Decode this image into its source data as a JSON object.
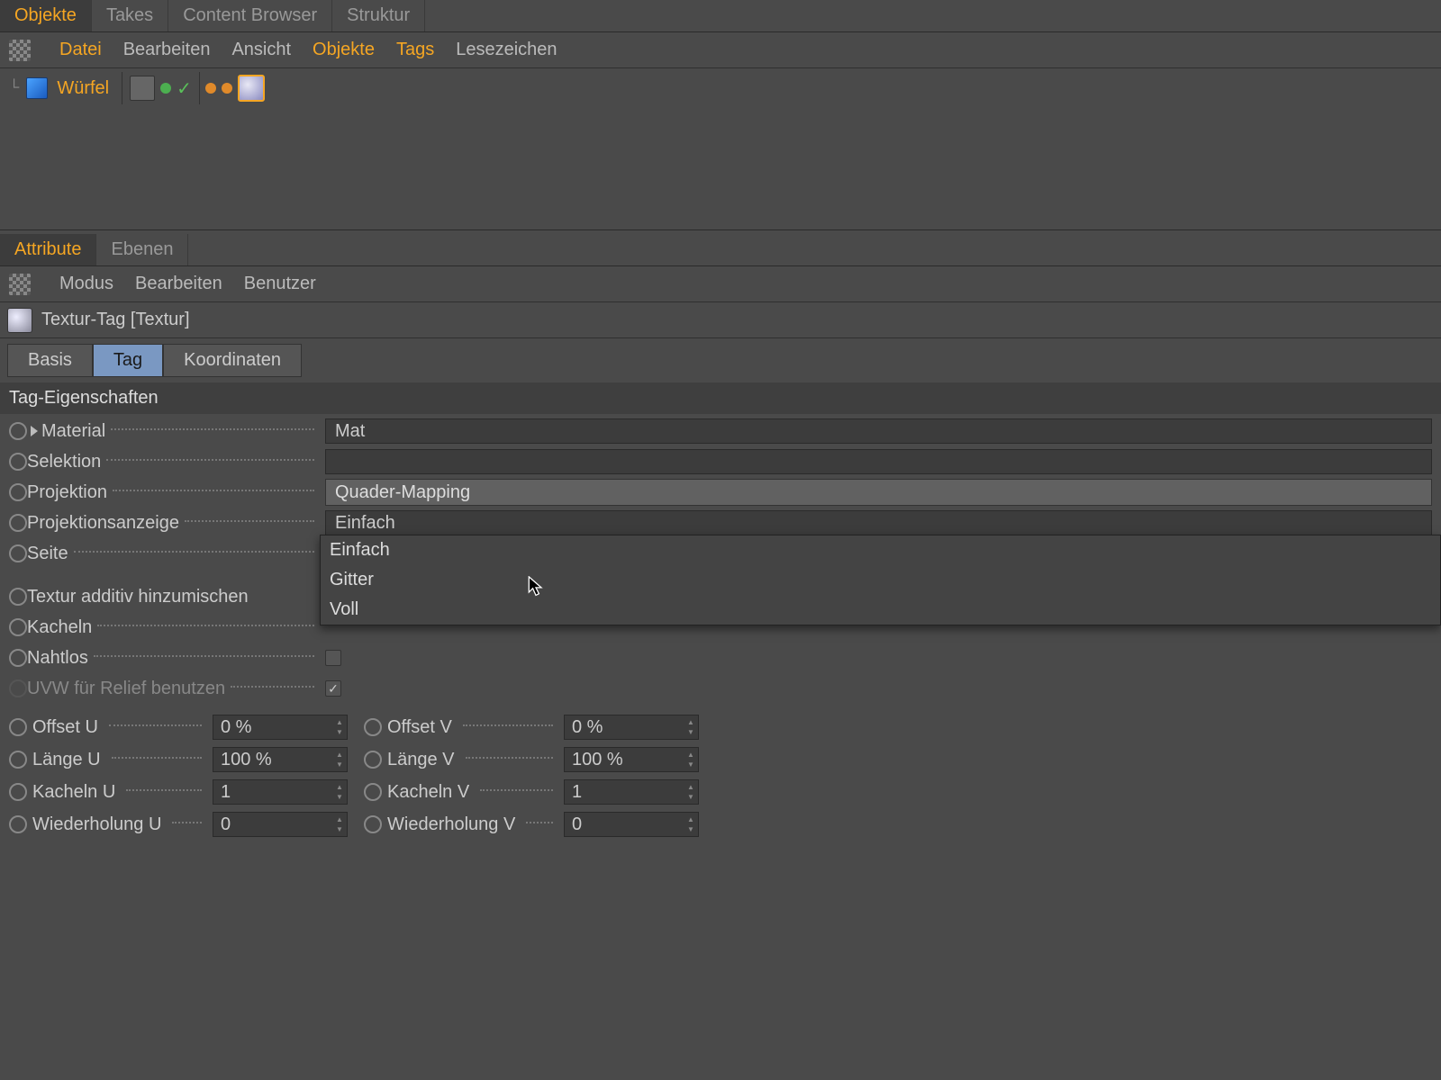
{
  "topTabs": {
    "objekte": "Objekte",
    "takes": "Takes",
    "content": "Content Browser",
    "struktur": "Struktur"
  },
  "topMenu": {
    "datei": "Datei",
    "bearbeiten": "Bearbeiten",
    "ansicht": "Ansicht",
    "objekte": "Objekte",
    "tags": "Tags",
    "lesezeichen": "Lesezeichen"
  },
  "object": {
    "name": "Würfel"
  },
  "lowerTabs": {
    "attribute": "Attribute",
    "ebenen": "Ebenen"
  },
  "attrMenu": {
    "modus": "Modus",
    "bearbeiten": "Bearbeiten",
    "benutzer": "Benutzer"
  },
  "attrTitle": "Textur-Tag [Textur]",
  "subTabs": {
    "basis": "Basis",
    "tag": "Tag",
    "koord": "Koordinaten"
  },
  "sectionHeader": "Tag-Eigenschaften",
  "props": {
    "material": {
      "label": "Material",
      "value": "Mat"
    },
    "selektion": {
      "label": "Selektion",
      "value": ""
    },
    "projektion": {
      "label": "Projektion",
      "value": "Quader-Mapping"
    },
    "projektionsanzeige": {
      "label": "Projektionsanzeige",
      "value": "Einfach"
    },
    "seite": {
      "label": "Seite",
      "value": ""
    },
    "additiv": {
      "label": "Textur additiv hinzumischen"
    },
    "kacheln": {
      "label": "Kacheln"
    },
    "nahtlos": {
      "label": "Nahtlos"
    },
    "uvw": {
      "label": "UVW für Relief benutzen"
    }
  },
  "dropdownOptions": {
    "opt0": "Einfach",
    "opt1": "Gitter",
    "opt2": "Voll"
  },
  "num": {
    "offsetU": {
      "label": "Offset U",
      "value": "0 %"
    },
    "offsetV": {
      "label": "Offset V",
      "value": "0 %"
    },
    "laengeU": {
      "label": "Länge U",
      "value": "100 %"
    },
    "laengeV": {
      "label": "Länge V",
      "value": "100 %"
    },
    "kachelnU": {
      "label": "Kacheln U",
      "value": "1"
    },
    "kachelnV": {
      "label": "Kacheln V",
      "value": "1"
    },
    "wiederU": {
      "label": "Wiederholung U",
      "value": "0"
    },
    "wiederV": {
      "label": "Wiederholung V",
      "value": "0"
    }
  }
}
